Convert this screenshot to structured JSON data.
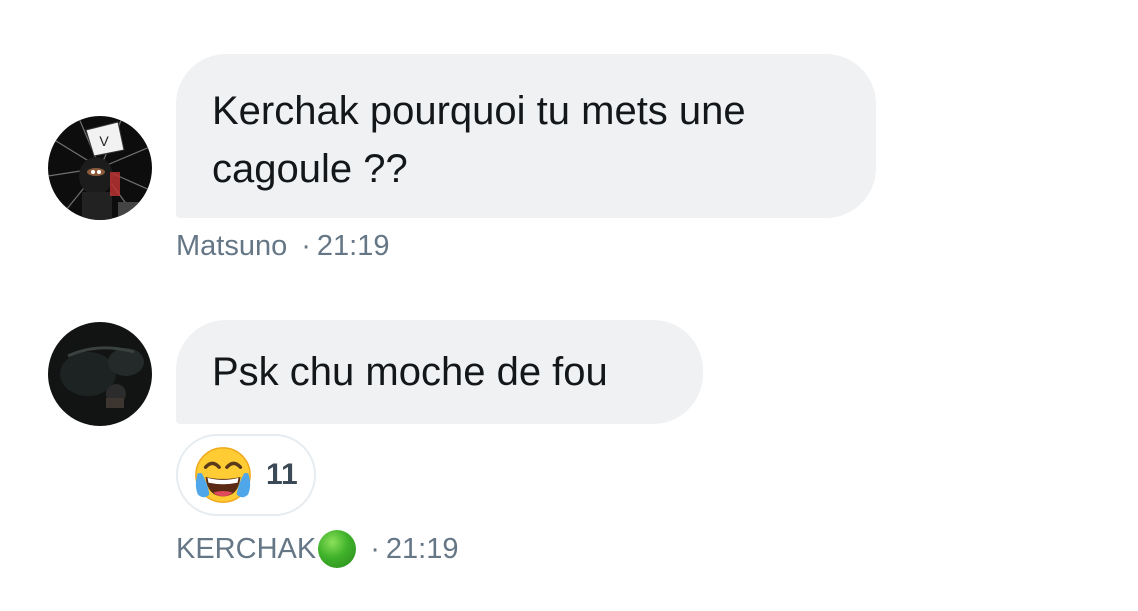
{
  "messages": [
    {
      "text_line1": "Kerchak pourquoi tu mets une",
      "text_line2": "cagoule ??",
      "author": "Matsuno",
      "separator": "·",
      "time": "21:19"
    },
    {
      "text": "Psk chu moche de fou",
      "reaction_emoji": "face-with-tears-of-joy",
      "reaction_count": "11",
      "author": "KERCHAK",
      "separator": "·",
      "time": "21:19"
    }
  ],
  "colors": {
    "bubble": "#eff1f3",
    "meta_text": "#657786",
    "status_dot": "#3fb12a"
  }
}
